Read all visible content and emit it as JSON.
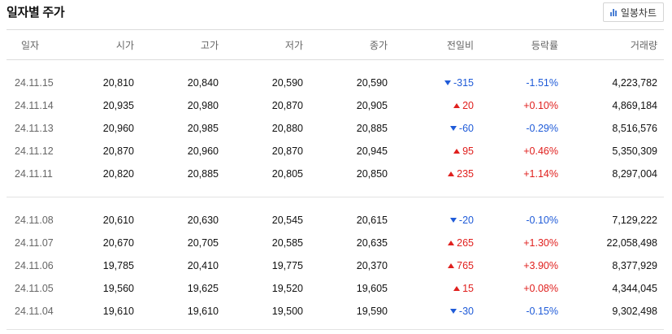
{
  "title": "일자별 주가",
  "chart_button": {
    "label": "일봉차트",
    "icon": "bar-chart-icon"
  },
  "colors": {
    "up": "#e0201e",
    "down": "#1f5bd8"
  },
  "columns": [
    "일자",
    "시가",
    "고가",
    "저가",
    "종가",
    "전일비",
    "등락률",
    "거래량"
  ],
  "groups": [
    [
      {
        "date": "24.11.15",
        "open": "20,810",
        "high": "20,840",
        "low": "20,590",
        "close": "20,590",
        "dir": "down",
        "change": "-315",
        "rate": "-1.51%",
        "volume": "4,223,782"
      },
      {
        "date": "24.11.14",
        "open": "20,935",
        "high": "20,980",
        "low": "20,870",
        "close": "20,905",
        "dir": "up",
        "change": "20",
        "rate": "+0.10%",
        "volume": "4,869,184"
      },
      {
        "date": "24.11.13",
        "open": "20,960",
        "high": "20,985",
        "low": "20,880",
        "close": "20,885",
        "dir": "down",
        "change": "-60",
        "rate": "-0.29%",
        "volume": "8,516,576"
      },
      {
        "date": "24.11.12",
        "open": "20,870",
        "high": "20,960",
        "low": "20,870",
        "close": "20,945",
        "dir": "up",
        "change": "95",
        "rate": "+0.46%",
        "volume": "5,350,309"
      },
      {
        "date": "24.11.11",
        "open": "20,820",
        "high": "20,885",
        "low": "20,805",
        "close": "20,850",
        "dir": "up",
        "change": "235",
        "rate": "+1.14%",
        "volume": "8,297,004"
      }
    ],
    [
      {
        "date": "24.11.08",
        "open": "20,610",
        "high": "20,630",
        "low": "20,545",
        "close": "20,615",
        "dir": "down",
        "change": "-20",
        "rate": "-0.10%",
        "volume": "7,129,222"
      },
      {
        "date": "24.11.07",
        "open": "20,670",
        "high": "20,705",
        "low": "20,585",
        "close": "20,635",
        "dir": "up",
        "change": "265",
        "rate": "+1.30%",
        "volume": "22,058,498"
      },
      {
        "date": "24.11.06",
        "open": "19,785",
        "high": "20,410",
        "low": "19,775",
        "close": "20,370",
        "dir": "up",
        "change": "765",
        "rate": "+3.90%",
        "volume": "8,377,929"
      },
      {
        "date": "24.11.05",
        "open": "19,560",
        "high": "19,625",
        "low": "19,520",
        "close": "19,605",
        "dir": "up",
        "change": "15",
        "rate": "+0.08%",
        "volume": "4,344,045"
      },
      {
        "date": "24.11.04",
        "open": "19,610",
        "high": "19,610",
        "low": "19,500",
        "close": "19,590",
        "dir": "down",
        "change": "-30",
        "rate": "-0.15%",
        "volume": "9,302,498"
      }
    ]
  ]
}
